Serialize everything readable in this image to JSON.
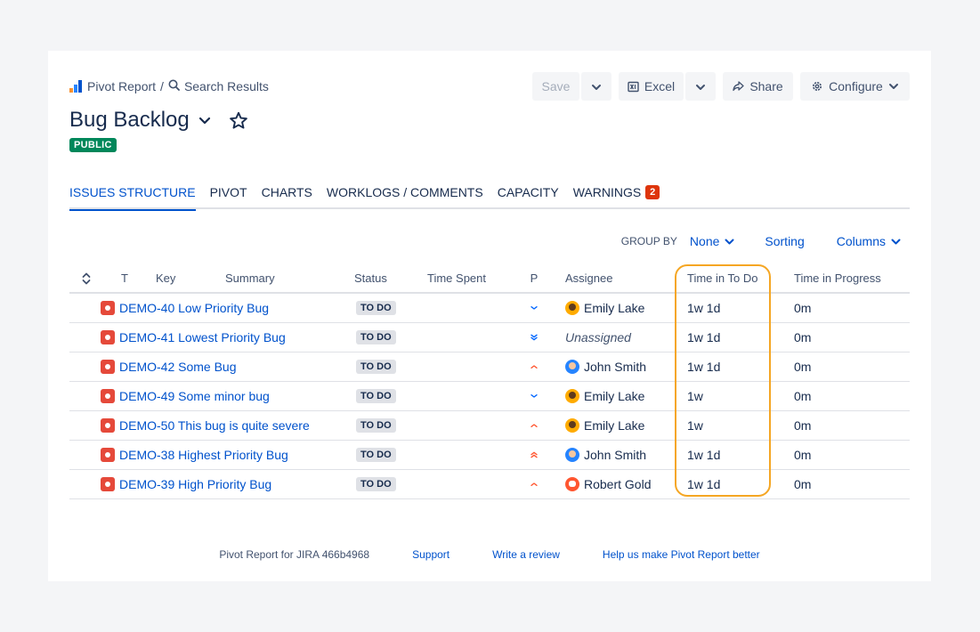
{
  "breadcrumb": {
    "app": "Pivot Report",
    "separator": "/",
    "page": "Search Results"
  },
  "toolbar": {
    "save": "Save",
    "excel": "Excel",
    "share": "Share",
    "configure": "Configure"
  },
  "title": "Bug Backlog",
  "badge": "PUBLIC",
  "tabs": [
    {
      "label": "ISSUES STRUCTURE",
      "active": true
    },
    {
      "label": "PIVOT"
    },
    {
      "label": "CHARTS"
    },
    {
      "label": "WORKLOGS / COMMENTS"
    },
    {
      "label": "CAPACITY"
    },
    {
      "label": "WARNINGS",
      "count": "2"
    }
  ],
  "controls": {
    "group_by_label": "GROUP BY",
    "group_by_value": "None",
    "sorting": "Sorting",
    "columns": "Columns"
  },
  "table": {
    "headers": {
      "t": "T",
      "key": "Key",
      "summary": "Summary",
      "status": "Status",
      "time_spent": "Time Spent",
      "p": "P",
      "assignee": "Assignee",
      "time_todo": "Time in To Do",
      "time_progress": "Time in Progress"
    },
    "rows": [
      {
        "key_summary": "DEMO-40 Low Priority Bug",
        "status": "TO DO",
        "priority": "low",
        "assignee": "Emily Lake",
        "avatar": "emily",
        "todo": "1w 1d",
        "progress": "0m"
      },
      {
        "key_summary": "DEMO-41 Lowest Priority Bug",
        "status": "TO DO",
        "priority": "lowest",
        "assignee": "Unassigned",
        "avatar": "",
        "todo": "1w 1d",
        "progress": "0m"
      },
      {
        "key_summary": "DEMO-42 Some Bug",
        "status": "TO DO",
        "priority": "high",
        "assignee": "John Smith",
        "avatar": "john",
        "todo": "1w 1d",
        "progress": "0m"
      },
      {
        "key_summary": "DEMO-49 Some minor bug",
        "status": "TO DO",
        "priority": "low",
        "assignee": "Emily Lake",
        "avatar": "emily",
        "todo": "1w",
        "progress": "0m"
      },
      {
        "key_summary": "DEMO-50 This bug is quite severe",
        "status": "TO DO",
        "priority": "high",
        "assignee": "Emily Lake",
        "avatar": "emily",
        "todo": "1w",
        "progress": "0m"
      },
      {
        "key_summary": "DEMO-38 Highest Priority Bug",
        "status": "TO DO",
        "priority": "highest",
        "assignee": "John Smith",
        "avatar": "john",
        "todo": "1w 1d",
        "progress": "0m"
      },
      {
        "key_summary": "DEMO-39 High Priority Bug",
        "status": "TO DO",
        "priority": "high",
        "assignee": "Robert Gold",
        "avatar": "robert",
        "todo": "1w 1d",
        "progress": "0m"
      }
    ]
  },
  "footer": {
    "version": "Pivot Report for JIRA 466b4968",
    "support": "Support",
    "review": "Write a review",
    "feedback": "Help us make Pivot Report better"
  },
  "colors": {
    "accent": "#0052cc",
    "issue_bug": "#e5493a",
    "highlight": "#f5a623",
    "badge_public": "#00875a",
    "warning_count": "#de350b"
  }
}
